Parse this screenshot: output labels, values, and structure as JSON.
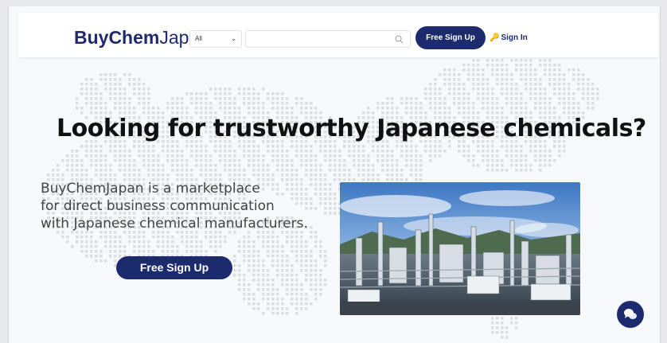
{
  "header": {
    "logo_bold": "BuyChem",
    "logo_light": "Japan",
    "category_selected": "All",
    "search_placeholder": "",
    "signup_label": "Free Sign Up",
    "signin_label": "Sign In"
  },
  "hero": {
    "headline": "Looking for trustworthy Japanese chemicals?",
    "description_lines": [
      "BuyChemJapan is a marketplace",
      "for direct business communication",
      "with Japanese chemical manufacturers."
    ],
    "cta_label": "Free Sign Up"
  },
  "colors": {
    "brand_navy": "#1c2a6e",
    "key_gold": "#d9a520",
    "background": "#f7f8fb"
  },
  "icons": {
    "search": "search-icon",
    "signin": "key-icon",
    "select": "chevron-down-icon",
    "chat": "chat-bubbles-icon"
  }
}
